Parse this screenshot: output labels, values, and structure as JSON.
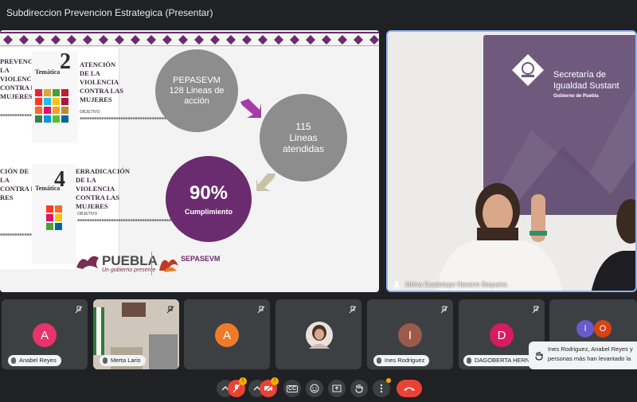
{
  "window": {
    "title": "Subdireccion Prevencion Estrategica (Presentar)"
  },
  "slide": {
    "left_doc": {
      "partial_heading_1": "PREVENCIÓN\nLA\nVIOLENCIA\nCONTRA LAS\nMUJERES",
      "tematica_label_1": "Temática",
      "tematica_num_1": "2",
      "heading_2": "ATENCIÓN\nDE LA\nVIOLENCIA\nCONTRA LAS\nMUJERES",
      "partial_heading_3": "CIÓN DE\nLA\nCONTRA LAS\nRES",
      "tematica_label_2": "Temática",
      "tematica_num_2": "4",
      "heading_4": "ERRADICACIÓN\nDE LA\nVIOLENCIA\nCONTRA LAS\nMUJERES",
      "objetivo_1": "OBJETIVO",
      "objetivo_2": "OBJETIVO"
    },
    "circle_1": {
      "line1": "PEPASEVM",
      "line2": "128 Lineas de",
      "line3": "acción"
    },
    "circle_2": {
      "line1": "115",
      "line2": "Lineas",
      "line3": "atendidas"
    },
    "circle_3": {
      "value": "90%",
      "label": "Cumplimiento"
    },
    "logo_puebla": "PUEBLA",
    "logo_puebla_sub": "Un gobierno presente",
    "logo_sepasevm": "SEPASEVM"
  },
  "speaker": {
    "name": "Melva Guadalupe Navarro Sequeira",
    "sign_line1": "Secretaría de",
    "sign_line2": "Igualdad Sustant",
    "sign_line3": "Gobierno de Puebla"
  },
  "participants": [
    {
      "name": "Anabel Reyes",
      "initial": "A",
      "color": "#e8336d"
    },
    {
      "name": "Merta Laris",
      "initial": "",
      "color": "#5f6368"
    },
    {
      "name": "",
      "initial": "A",
      "color": "#f07a2a"
    },
    {
      "name": "",
      "initial": "",
      "color": "#5f6368"
    },
    {
      "name": "Ines Rodriguez",
      "initial": "I",
      "color": "#9c5a4a"
    },
    {
      "name": "DAGOBERTA HERNA...",
      "initial": "D",
      "color": "#d81b60"
    },
    {
      "name": "",
      "initial": "I",
      "color": "#6a5acd"
    }
  ],
  "extra_avatar_initial": "O",
  "notification": {
    "line1": "Ines Rodriguez, Anabel Reyes y",
    "line2": "personas más han levantado la"
  },
  "controls": {
    "mic_badge": "!",
    "cam_badge": "!",
    "cc_label": "CC",
    "accent_red": "#ea4335",
    "accent_blue": "#8ab4f8"
  }
}
